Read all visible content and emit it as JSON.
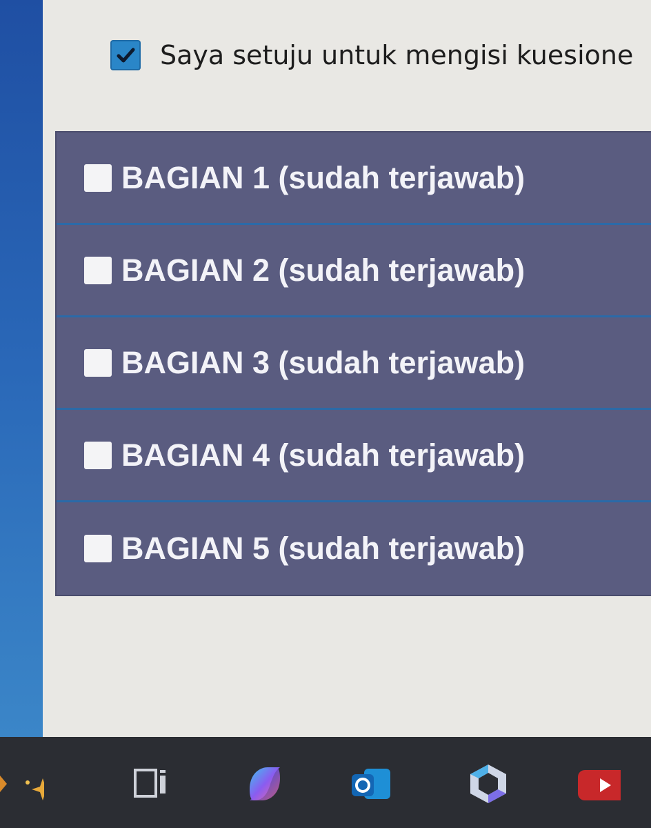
{
  "consent": {
    "label": "Saya setuju untuk mengisi kuesione",
    "checked": true
  },
  "sections": [
    {
      "label": "BAGIAN 1 (sudah terjawab)"
    },
    {
      "label": "BAGIAN 2 (sudah terjawab)"
    },
    {
      "label": "BAGIAN 3 (sudah terjawab)"
    },
    {
      "label": "BAGIAN 4 (sudah terjawab)"
    },
    {
      "label": "BAGIAN 5 (sudah terjawab)"
    }
  ],
  "taskbar": {
    "icons": [
      "widgets-icon",
      "task-view-icon",
      "copilot-icon",
      "outlook-icon",
      "microsoft-365-icon",
      "youtube-icon"
    ]
  },
  "colors": {
    "checkbox_accent": "#2a86c8",
    "section_background": "#5a5c80",
    "section_divider": "#2b6aa8",
    "section_text": "#f3f3f8",
    "taskbar": "#2b2d33"
  }
}
